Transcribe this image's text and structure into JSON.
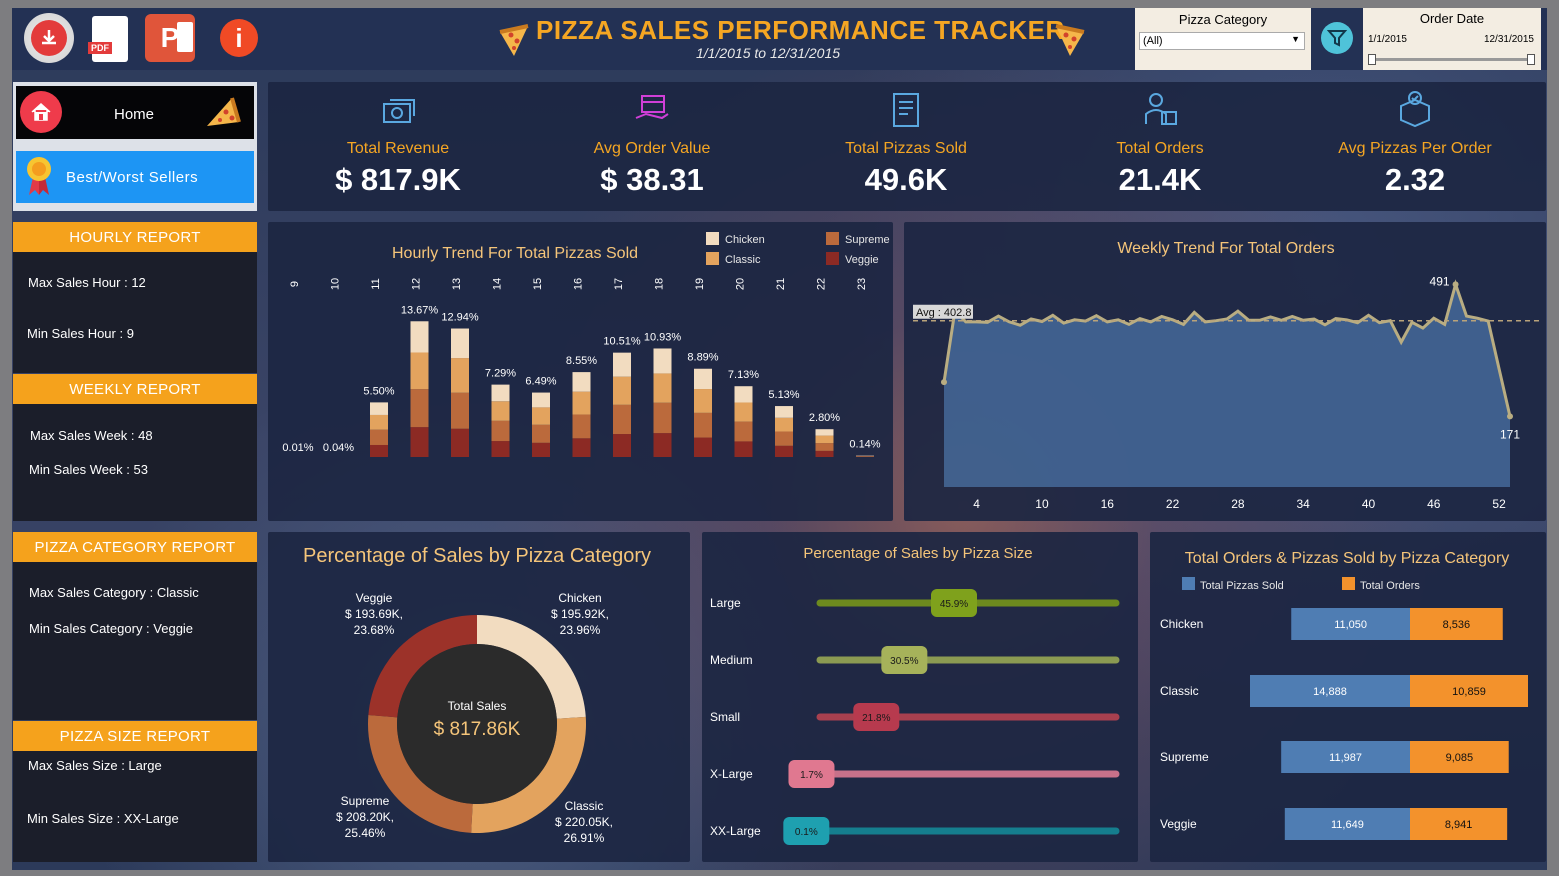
{
  "header": {
    "title": "PIZZA SALES PERFORMANCE TRACKER",
    "date_range": "1/1/2015 to 12/31/2015",
    "icons": [
      "download-icon",
      "pdf-icon",
      "powerpoint-icon",
      "info-icon"
    ],
    "pdf_label": "PDF",
    "ppt_label": "P",
    "info_label": "i"
  },
  "filters": {
    "category_label": "Pizza Category",
    "category_value": "(All)",
    "date_label": "Order Date",
    "date_start": "1/1/2015",
    "date_end": "12/31/2015"
  },
  "nav": {
    "home_label": "Home",
    "best_worst_label": "Best/Worst Sellers"
  },
  "reports": {
    "hourly": {
      "title": "HOURLY REPORT",
      "max": "Max Sales Hour : 12",
      "min": "Min Sales Hour : 9"
    },
    "weekly": {
      "title": "WEEKLY REPORT",
      "max": "Max Sales Week : 48",
      "min": "Min Sales Week :   53"
    },
    "category": {
      "title": "PIZZA CATEGORY REPORT",
      "max": "Max Sales Category  :  Classic",
      "min": "Min Sales Category :  Veggie"
    },
    "size": {
      "title": "PIZZA SIZE REPORT",
      "max": "Max Sales Size  :  Large",
      "min": "Min Sales Size  :  XX-Large"
    }
  },
  "kpis": [
    {
      "label": "Total Revenue",
      "value": "$ 817.9K",
      "icon": "money-icon"
    },
    {
      "label": "Avg Order Value",
      "value": "$ 38.31",
      "icon": "hand-box-icon"
    },
    {
      "label": "Total Pizzas Sold",
      "value": "49.6K",
      "icon": "clipboard-pizza-icon"
    },
    {
      "label": "Total Orders",
      "value": "21.4K",
      "icon": "delivery-person-icon"
    },
    {
      "label": "Avg Pizzas Per Order",
      "value": "2.32",
      "icon": "box-check-icon"
    }
  ],
  "colors": {
    "chicken": "#f2dcc0",
    "classic": "#e3a35e",
    "supreme": "#bb6a3c",
    "veggie": "#8c2a24",
    "accent": "#f5a623",
    "blue_bar": "#4f7db3",
    "orange_bar": "#f3922c"
  },
  "chart_data": [
    {
      "type": "bar",
      "title": "Hourly Trend For Total Pizzas Sold",
      "categories": [
        "9",
        "10",
        "11",
        "12",
        "13",
        "14",
        "15",
        "16",
        "17",
        "18",
        "19",
        "20",
        "21",
        "22",
        "23"
      ],
      "labels": [
        "0.01%",
        "0.04%",
        "5.50%",
        "13.67%",
        "12.94%",
        "7.29%",
        "6.49%",
        "8.55%",
        "10.51%",
        "10.93%",
        "8.89%",
        "7.13%",
        "5.13%",
        "2.80%",
        "0.14%"
      ],
      "values": [
        0.01,
        0.04,
        5.5,
        13.67,
        12.94,
        7.29,
        6.49,
        8.55,
        10.51,
        10.93,
        8.89,
        7.13,
        5.13,
        2.8,
        0.14
      ],
      "series": [
        {
          "name": "Chicken",
          "color": "#f2dcc0"
        },
        {
          "name": "Classic",
          "color": "#e3a35e"
        },
        {
          "name": "Supreme",
          "color": "#bb6a3c"
        },
        {
          "name": "Veggie",
          "color": "#8c2a24"
        }
      ],
      "legend_order": [
        "Chicken",
        "Supreme",
        "Classic",
        "Veggie"
      ],
      "ylim": [
        0,
        14
      ]
    },
    {
      "type": "area",
      "title": "Weekly Trend For Total Orders",
      "x": [
        1,
        2,
        3,
        4,
        5,
        6,
        7,
        8,
        9,
        10,
        11,
        12,
        13,
        14,
        15,
        16,
        17,
        18,
        19,
        20,
        21,
        22,
        23,
        24,
        25,
        26,
        27,
        28,
        29,
        30,
        31,
        32,
        33,
        34,
        35,
        36,
        37,
        38,
        39,
        40,
        41,
        42,
        43,
        44,
        45,
        46,
        47,
        48,
        49,
        50,
        51,
        52,
        53
      ],
      "values": [
        254,
        427,
        400,
        400,
        399,
        414,
        400,
        392,
        407,
        401,
        416,
        397,
        405,
        402,
        415,
        400,
        405,
        394,
        408,
        400,
        413,
        405,
        394,
        423,
        400,
        403,
        407,
        426,
        404,
        404,
        412,
        404,
        413,
        404,
        407,
        393,
        408,
        405,
        398,
        416,
        398,
        403,
        351,
        399,
        385,
        409,
        394,
        491,
        414,
        409,
        402,
        286,
        171
      ],
      "x_ticks": [
        "4",
        "10",
        "16",
        "22",
        "28",
        "34",
        "40",
        "46",
        "52"
      ],
      "x_tick_values": [
        4,
        10,
        16,
        22,
        28,
        34,
        40,
        46,
        52
      ],
      "avg": 402.8,
      "avg_label": "Avg : 402.8",
      "max_label": "491",
      "min_label": "171",
      "ylim": [
        0,
        550
      ]
    },
    {
      "type": "pie",
      "title": "Percentage of Sales by Pizza Category",
      "center_label": "Total Sales",
      "center_value": "$ 817.86K",
      "slices": [
        {
          "name": "Chicken",
          "value": 195.92,
          "pct": 23.96,
          "color": "#f2dcc0",
          "line1": "Chicken",
          "line2": "$ 195.92K,",
          "line3": "23.96%"
        },
        {
          "name": "Classic",
          "value": 220.05,
          "pct": 26.91,
          "color": "#e3a35e",
          "line1": "Classic",
          "line2": "$ 220.05K,",
          "line3": "26.91%"
        },
        {
          "name": "Supreme",
          "value": 208.2,
          "pct": 25.46,
          "color": "#bb6a3c",
          "line1": "Supreme",
          "line2": "$ 208.20K,",
          "line3": "25.46%"
        },
        {
          "name": "Veggie",
          "value": 193.69,
          "pct": 23.68,
          "color": "#9c3229",
          "line1": "Veggie",
          "line2": "$ 193.69K,",
          "line3": "23.68%"
        }
      ]
    },
    {
      "type": "bar",
      "title": "Percentage of Sales by Pizza Size",
      "categories": [
        "Large",
        "Medium",
        "Small",
        "X-Large",
        "XX-Large"
      ],
      "values": [
        45.9,
        30.5,
        21.8,
        1.7,
        0.1
      ],
      "labels": [
        "45.9%",
        "30.5%",
        "21.8%",
        "1.7%",
        "0.1%"
      ],
      "colors": [
        "#7fa11c",
        "#a6b25a",
        "#b73a4e",
        "#e07890",
        "#1ea0b0"
      ],
      "track_colors": [
        "#6d8a1e",
        "#8b9a52",
        "#a8404f",
        "#c7718a",
        "#157e8e"
      ]
    },
    {
      "type": "bar",
      "title": "Total Orders & Pizzas Sold by Pizza Category",
      "categories": [
        "Chicken",
        "Classic",
        "Supreme",
        "Veggie"
      ],
      "series": [
        {
          "name": "Total Pizzas Sold",
          "values": [
            11050,
            14888,
            11987,
            11649
          ],
          "labels": [
            "11,050",
            "14,888",
            "11,987",
            "11,649"
          ],
          "color": "#4f7db3"
        },
        {
          "name": "Total Orders",
          "values": [
            8536,
            10859,
            9085,
            8941
          ],
          "labels": [
            "8,536",
            "10,859",
            "9,085",
            "8,941"
          ],
          "color": "#f3922c"
        }
      ]
    }
  ]
}
